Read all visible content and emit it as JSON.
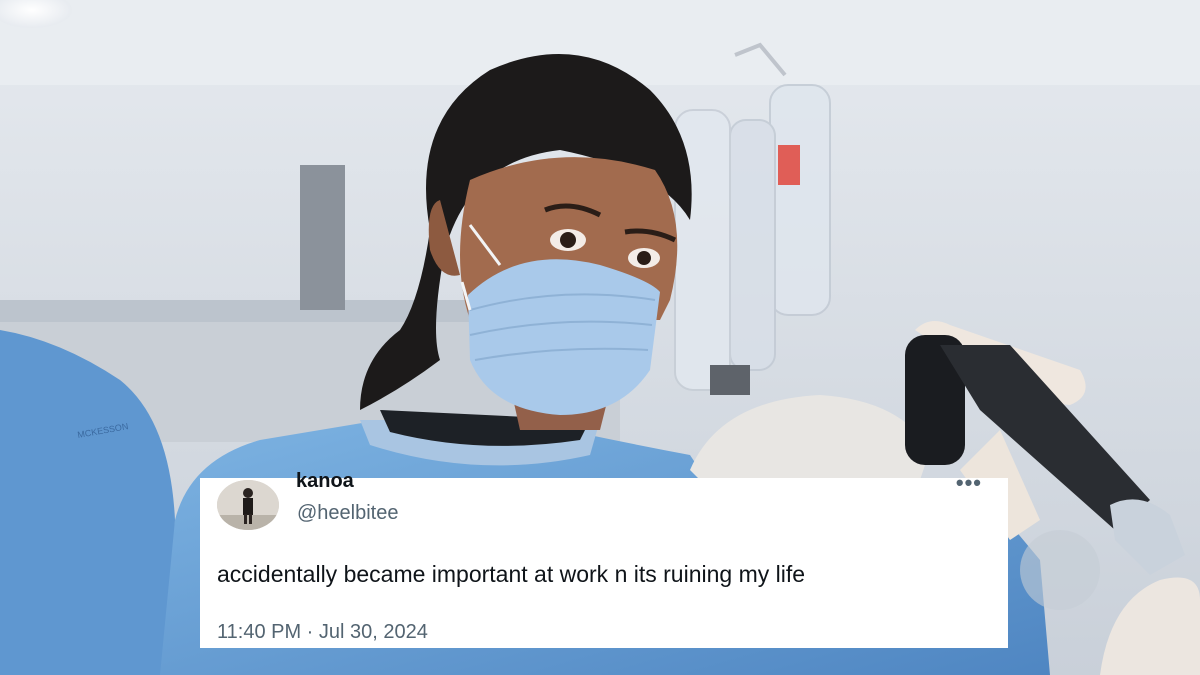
{
  "tweet": {
    "display_name": "kanoa",
    "handle": "@heelbitee",
    "more_icon": "more-horizontal-icon",
    "text": "accidentally became important at work n its ruining my life",
    "timestamp": "11:40 PM · Jul 30, 2024"
  },
  "scene": {
    "scrub_label": "MCKESSON"
  },
  "colors": {
    "scrub_blue": "#6fa6d8",
    "mask_blue": "#a9c9ea",
    "wall": "#dfe4ea",
    "text_primary": "#0f1419",
    "text_secondary": "#536471"
  }
}
